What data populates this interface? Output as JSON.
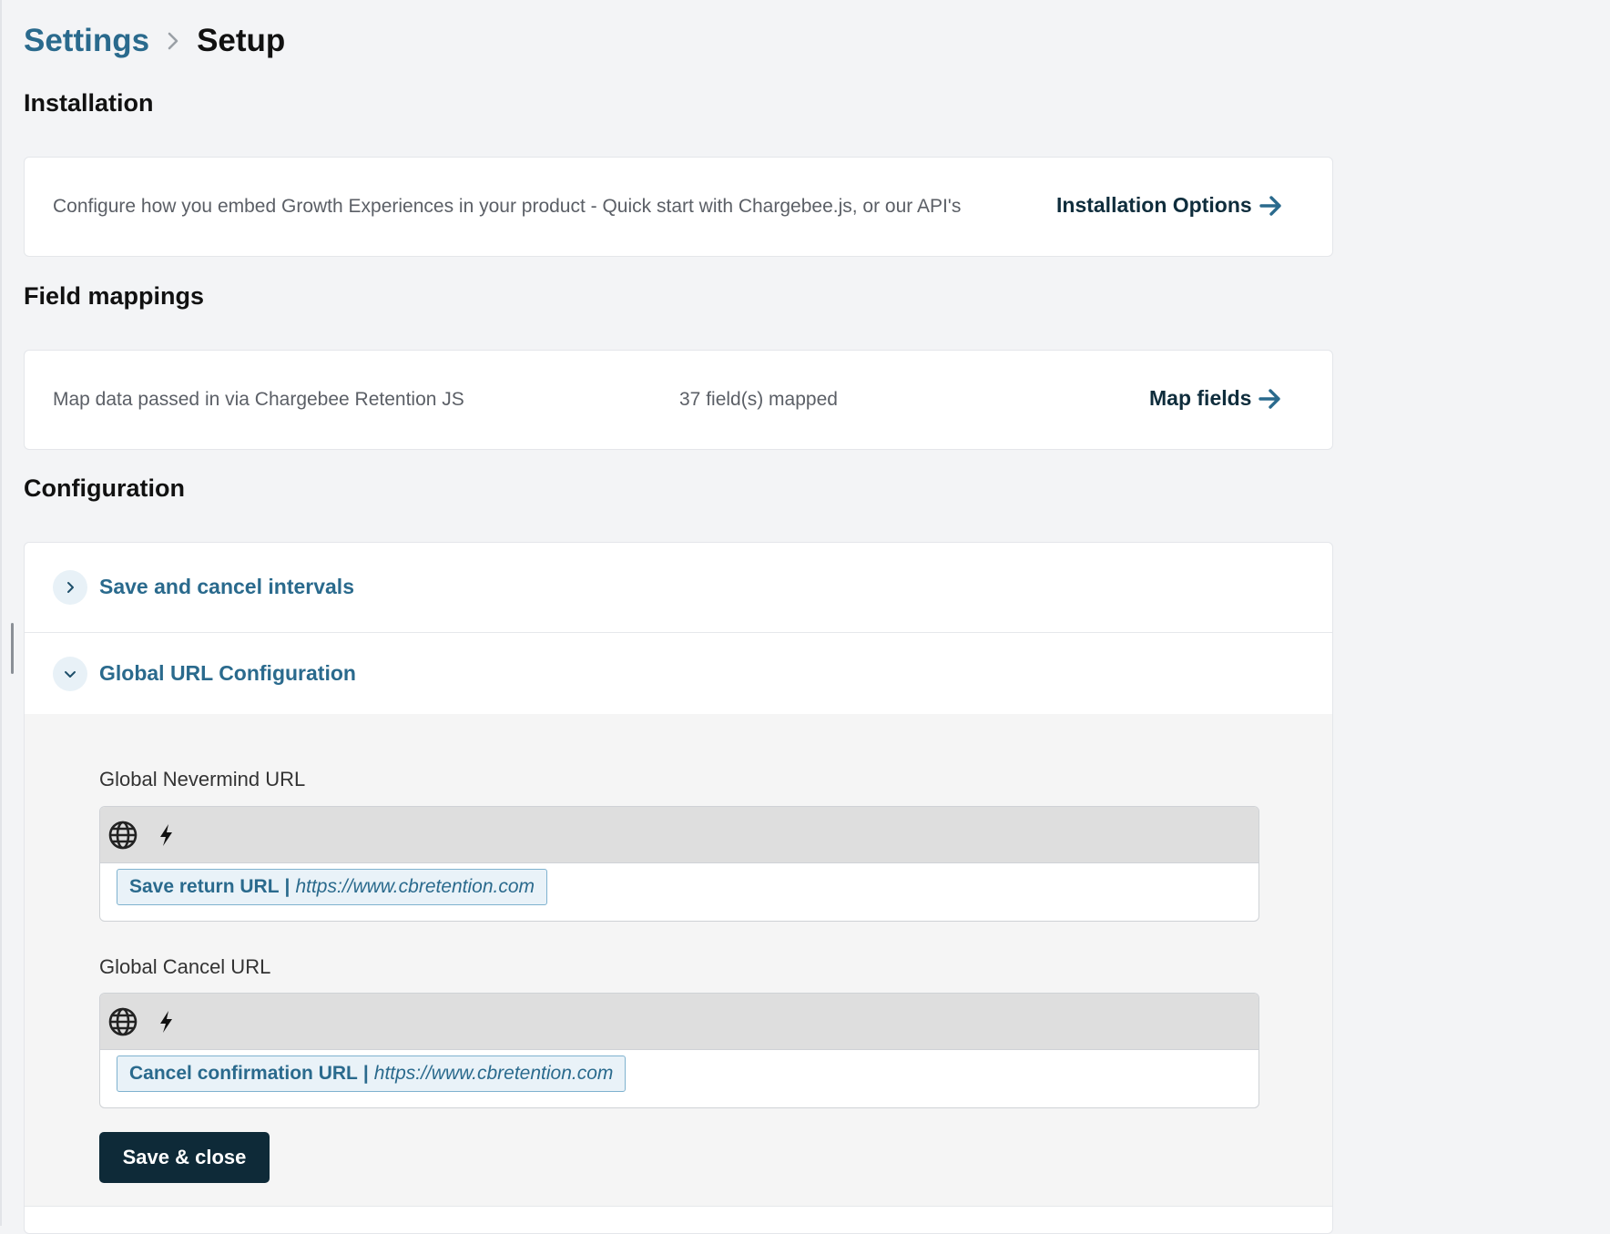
{
  "breadcrumb": {
    "root": "Settings",
    "current": "Setup"
  },
  "installation": {
    "heading": "Installation",
    "description": "Configure how you embed Growth Experiences in your product - Quick start with Chargebee.js, or our API's",
    "link_label": "Installation Options"
  },
  "field_mappings": {
    "heading": "Field mappings",
    "description": "Map data passed in via Chargebee Retention JS",
    "count_text": "37 field(s) mapped",
    "link_label": "Map fields"
  },
  "configuration": {
    "heading": "Configuration",
    "sections": [
      {
        "title": "Save and cancel intervals",
        "expanded": false
      },
      {
        "title": "Global URL Configuration",
        "expanded": true
      }
    ],
    "nevermind": {
      "label": "Global Nevermind URL",
      "chip_label": "Save return URL",
      "chip_sep": "|",
      "chip_url": "https://www.cbretention.com"
    },
    "cancel": {
      "label": "Global Cancel URL",
      "chip_label": "Cancel confirmation URL",
      "chip_sep": "|",
      "chip_url": "https://www.cbretention.com"
    },
    "save_label": "Save & close"
  },
  "icons": {
    "breadcrumb_separator": "chevron-right-icon",
    "link_arrow": "arrow-right-icon",
    "collapsed_toggle": "chevron-right-icon",
    "expanded_toggle": "chevron-down-icon",
    "toolbar_globe": "globe-icon",
    "toolbar_bolt": "lightning-bolt-icon"
  },
  "colors": {
    "accent": "#2a6a8d",
    "link_dark": "#0f2d3c",
    "button_bg": "#0e2a38",
    "page_bg": "#f3f4f6",
    "chip_bg": "#e9f2f8",
    "chip_border": "#7fb2cf"
  }
}
